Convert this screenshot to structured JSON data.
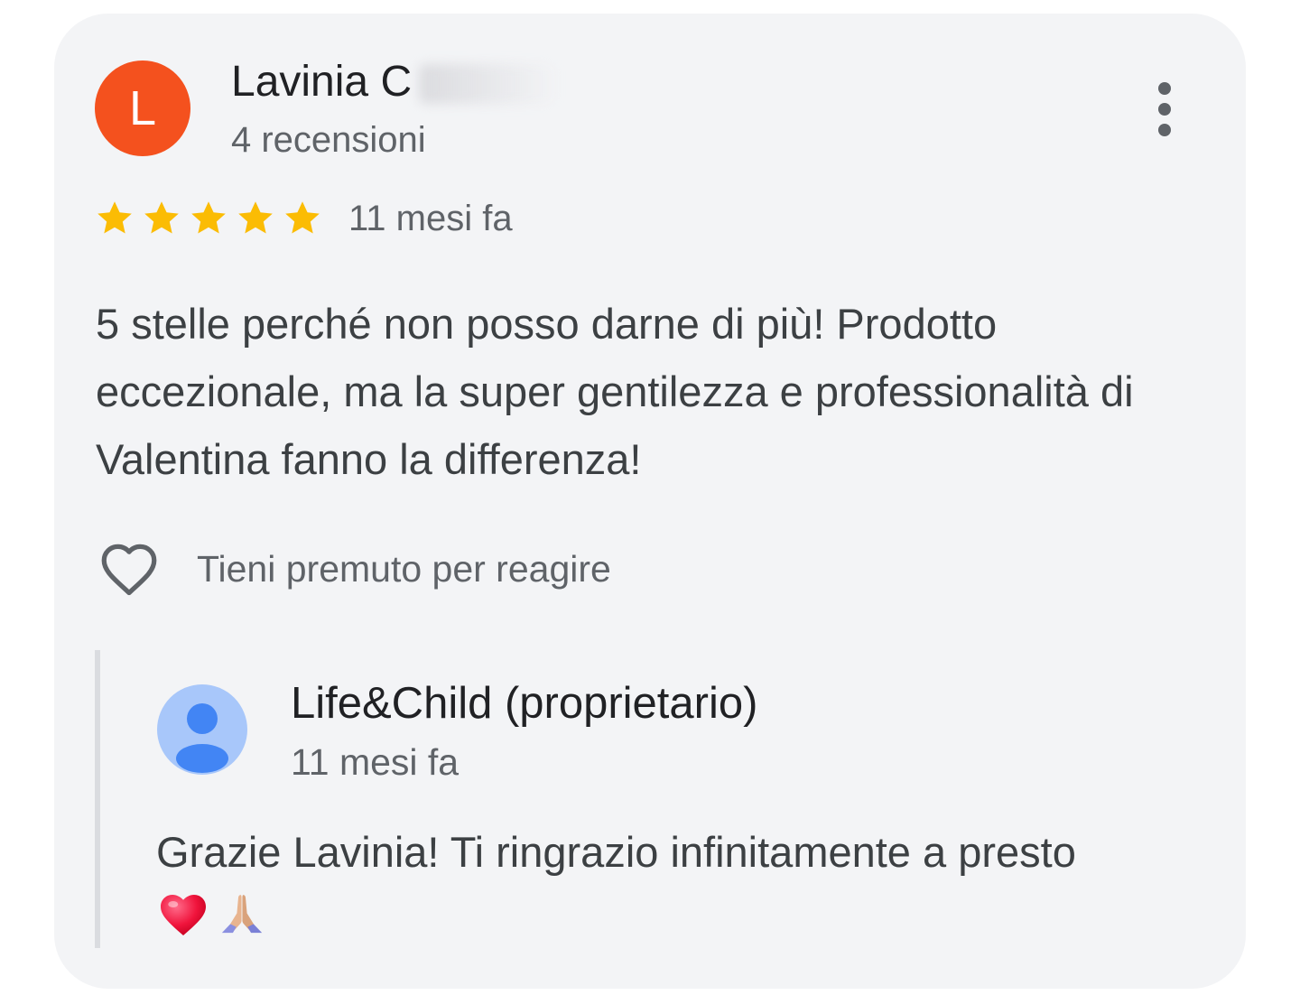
{
  "review": {
    "reviewer_initial": "L",
    "reviewer_name": "Lavinia C",
    "review_count": "4 recensioni",
    "rating": 5,
    "rating_max": 5,
    "time": "11 mesi fa",
    "text": "5 stelle perché non posso darne di più! Prodotto eccezionale, ma la super gentilezza e professionalità di Valentina fanno la differenza!",
    "react_hint": "Tieni premuto per reagire"
  },
  "reply": {
    "owner_name": "Life&Child (proprietario)",
    "time": "11 mesi fa",
    "text": "Grazie Lavinia! Ti ringrazio infinitamente a presto",
    "emojis": [
      "red-heart",
      "folded-hands"
    ]
  },
  "colors": {
    "card_background": "#f3f4f6",
    "reviewer_avatar": "#f4511e",
    "star": "#fbbc04",
    "owner_avatar_bg": "#a8c7fa",
    "owner_avatar_fg": "#4285f4",
    "reply_bar": "#dadce0"
  },
  "icons": {
    "more": "more-vert-icon",
    "react": "heart-outline-icon",
    "star": "star-icon",
    "owner_avatar": "person-icon"
  }
}
